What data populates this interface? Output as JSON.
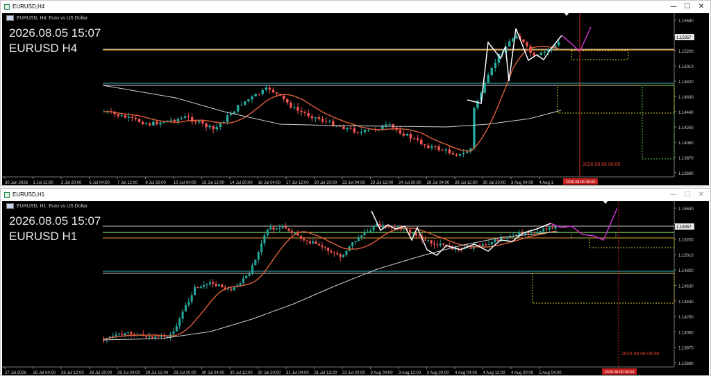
{
  "windows": [
    {
      "id": "h4",
      "title": "EURUSD,H4",
      "header": "EURUSD, H4:  Euro vs US Dollar",
      "overlay_time": "2026.08.05 15:07",
      "overlay_symbol": "EURUSD H4",
      "price_labels": [
        "1.15590",
        "1.15357",
        "1.15200",
        "1.15010",
        "1.14820",
        "1.14630",
        "1.14440",
        "1.14250",
        "1.14060",
        "1.13870",
        "1.13680"
      ],
      "current_price": "1.15357",
      "time_labels": [
        "30 Jun 2026",
        "1 Jul 12:00",
        "2 Jul 20:00",
        "6 Jul 04:00",
        "7 Jul 12:00",
        "8 Jul 20:00",
        "10 Jul 04:00",
        "13 Jul 12:00",
        "14 Jul 20:00",
        "16 Jul 04:00",
        "17 Jul 12:00",
        "20 Jul 20:00",
        "22 Jul 04:00",
        "23 Jul 12:00",
        "24 Jul 20:00",
        "28 Jul 04:00",
        "29 Jul 12:00",
        "30 Jul 20:00",
        "3 Aug 04:00",
        "4 Aug 1"
      ],
      "future_time_label": "2026.08.06 06:00",
      "vline_label": "2026.08.06 06:00"
    },
    {
      "id": "h1",
      "title": "EURUSD,H1",
      "header": "EURUSD, H1:  Euro vs US Dollar",
      "overlay_time": "2026.08.05 15:07",
      "overlay_symbol": "EURUSD H1",
      "price_labels": [
        "1.15590",
        "1.15357",
        "1.15200",
        "1.15010",
        "1.14820",
        "1.14630",
        "1.14440",
        "1.14250",
        "1.14060",
        "1.13870",
        "1.13680"
      ],
      "current_price": "1.15357",
      "time_labels": [
        "27 Jul 2026",
        "28 Jul 04:00",
        "28 Jul 12:00",
        "28 Jul 20:00",
        "29 Jul 04:00",
        "29 Jul 12:00",
        "29 Jul 20:00",
        "30 Jul 04:00",
        "30 Jul 12:00",
        "30 Jul 20:00",
        "31 Jul 04:00",
        "31 Jul 12:00",
        "31 Jul 20:00",
        "3 Aug 04:00",
        "3 Aug 12:00",
        "3 Aug 20:00",
        "4 Aug 04:00",
        "4 Aug 12:00",
        "4 Aug 20:00",
        "5 Aug 04:00"
      ],
      "future_time_label": "2026.08.06 06:00",
      "vline_label": "2026.08.06 06:00"
    }
  ],
  "window_buttons": {
    "minimize": "—",
    "maximize": "☐",
    "close": "✕"
  },
  "colors": {
    "bull": "#26a69a",
    "bear": "#ef5350",
    "ma_fast": "#e0603a",
    "ma_slow": "#d0d0d0",
    "zigzag": "#ffffff",
    "projection": "#cc33cc",
    "hline_green": "#7fd35a",
    "hline_orange": "#f0a030",
    "hline_cyan": "#40b0c0",
    "hline_white": "#c8c8c8",
    "vline": "#d03020",
    "box": "#d8c820",
    "green_box": "#5ac85a"
  }
}
